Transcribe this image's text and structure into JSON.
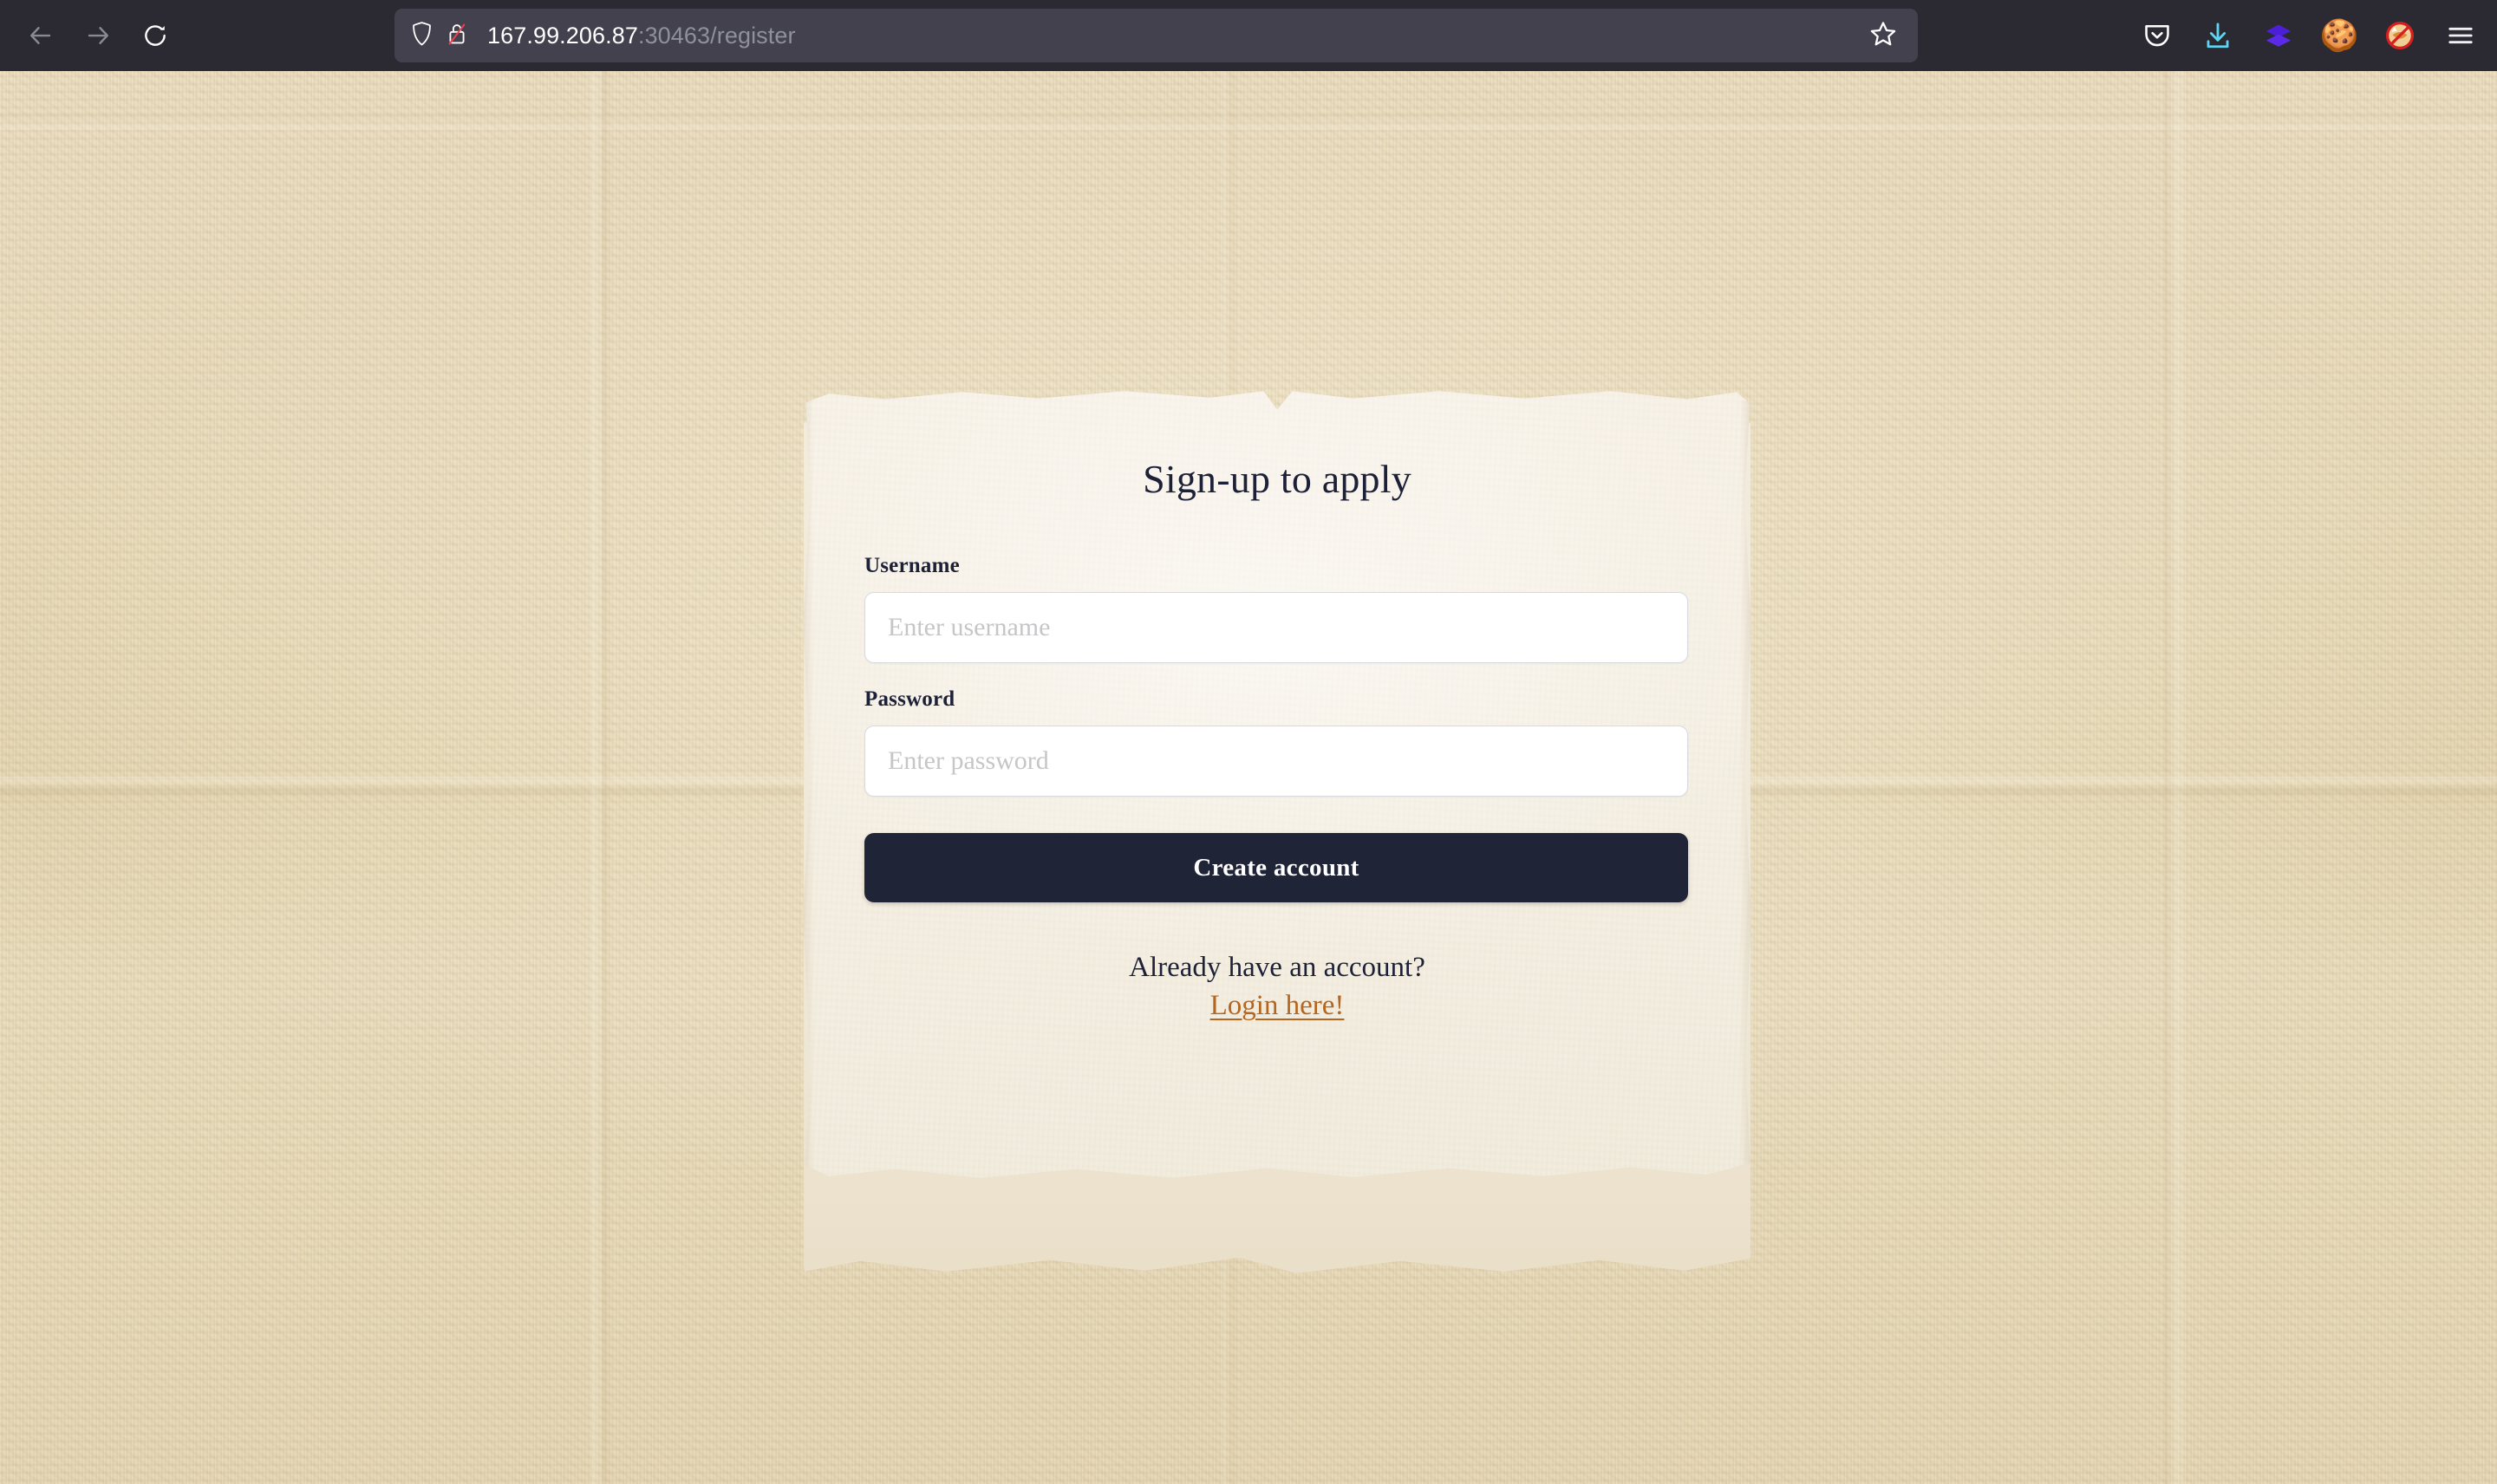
{
  "browser": {
    "back_icon": "back-arrow-icon",
    "forward_icon": "forward-arrow-icon",
    "reload_icon": "reload-icon",
    "shield_icon": "shield-icon",
    "insecure_lock_icon": "lock-slash-icon",
    "url_host": "167.99.206.87",
    "url_rest": ":30463/register",
    "url_full": "167.99.206.87:30463/register",
    "bookmark_icon": "star-outline-icon",
    "toolbar": [
      {
        "name": "pocket-icon",
        "label": "Pocket"
      },
      {
        "name": "download-icon",
        "label": "Downloads"
      },
      {
        "name": "layers-extension-icon",
        "label": "Extension"
      },
      {
        "name": "cookie-extension-icon",
        "label": "Cookie Manager",
        "glyph": "🍪"
      },
      {
        "name": "no-fox-extension-icon",
        "label": "Blocker"
      },
      {
        "name": "hamburger-menu-icon",
        "label": "Open application menu"
      }
    ]
  },
  "card": {
    "title": "Sign-up to apply",
    "fields": [
      {
        "label": "Username",
        "placeholder": "Enter username",
        "value": "",
        "type": "text",
        "name": "username"
      },
      {
        "label": "Password",
        "placeholder": "Enter password",
        "value": "",
        "type": "password",
        "name": "password"
      }
    ],
    "submit_label": "Create account",
    "footer_question": "Already have an account?",
    "footer_link": "Login here!"
  },
  "colors": {
    "page_background": "#e5d6b3",
    "card_background": "#f6f0e4",
    "ink": "#1d2138",
    "button": "#1f2437",
    "link": "#b5651d",
    "input_background": "#ffffff",
    "input_border": "#d7dbe0",
    "placeholder": "#c6c6c8",
    "chrome_background": "#2b2a33",
    "urlbar_background": "#42414d"
  }
}
